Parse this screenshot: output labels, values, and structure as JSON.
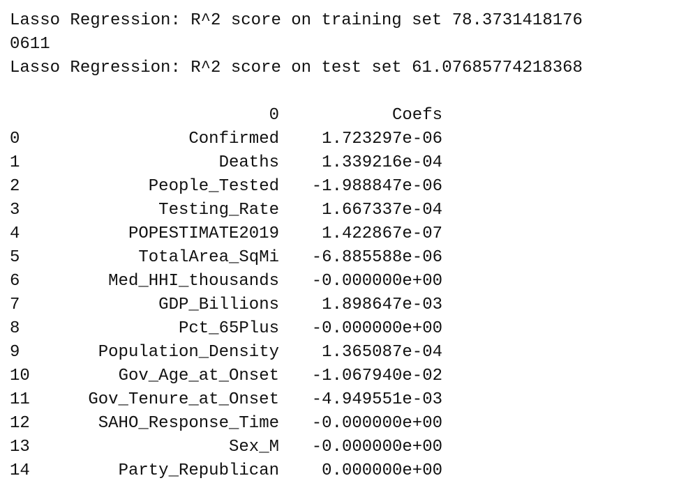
{
  "output": {
    "line1": "Lasso Regression: R^2 score on training set 78.3731418176",
    "line2": "0611",
    "line3": "Lasso Regression: R^2 score on test set 61.07685774218368"
  },
  "table": {
    "header": {
      "index": "",
      "col0": "0",
      "col1": "Coefs"
    },
    "rows": [
      {
        "index": "0",
        "feature": "Confirmed",
        "coef": "1.723297e-06"
      },
      {
        "index": "1",
        "feature": "Deaths",
        "coef": "1.339216e-04"
      },
      {
        "index": "2",
        "feature": "People_Tested",
        "coef": "-1.988847e-06"
      },
      {
        "index": "3",
        "feature": "Testing_Rate",
        "coef": "1.667337e-04"
      },
      {
        "index": "4",
        "feature": "POPESTIMATE2019",
        "coef": "1.422867e-07"
      },
      {
        "index": "5",
        "feature": "TotalArea_SqMi",
        "coef": "-6.885588e-06"
      },
      {
        "index": "6",
        "feature": "Med_HHI_thousands",
        "coef": "-0.000000e+00"
      },
      {
        "index": "7",
        "feature": "GDP_Billions",
        "coef": "1.898647e-03"
      },
      {
        "index": "8",
        "feature": "Pct_65Plus",
        "coef": "-0.000000e+00"
      },
      {
        "index": "9",
        "feature": "Population_Density",
        "coef": "1.365087e-04"
      },
      {
        "index": "10",
        "feature": "Gov_Age_at_Onset",
        "coef": "-1.067940e-02"
      },
      {
        "index": "11",
        "feature": "Gov_Tenure_at_Onset",
        "coef": "-4.949551e-03"
      },
      {
        "index": "12",
        "feature": "SAHO_Response_Time",
        "coef": "-0.000000e+00"
      },
      {
        "index": "13",
        "feature": "Sex_M",
        "coef": "-0.000000e+00"
      },
      {
        "index": "14",
        "feature": "Party_Republican",
        "coef": "0.000000e+00"
      }
    ]
  }
}
